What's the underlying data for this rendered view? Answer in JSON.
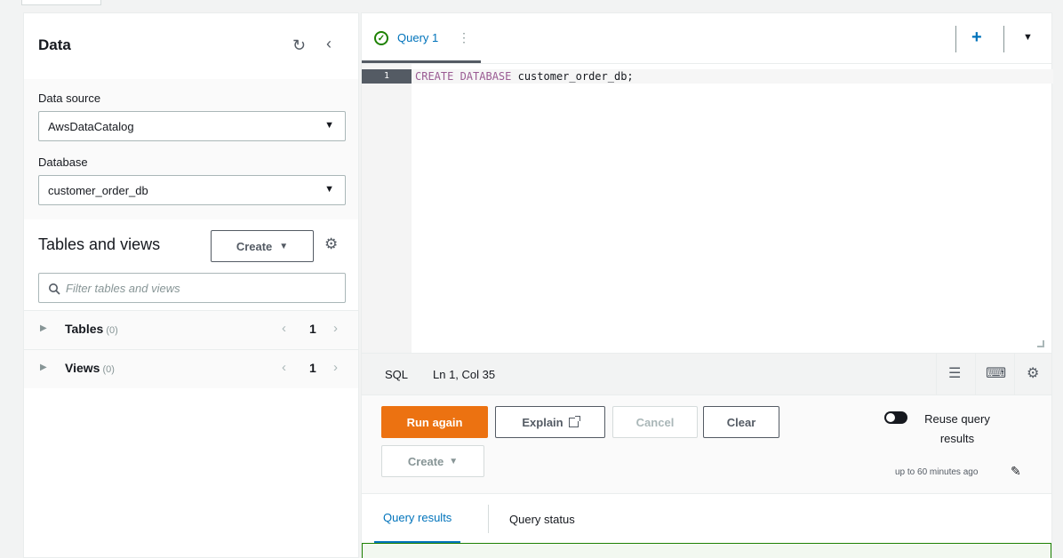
{
  "data_panel": {
    "title": "Data",
    "data_source_label": "Data source",
    "data_source_value": "AwsDataCatalog",
    "database_label": "Database",
    "database_value": "customer_order_db",
    "tables_views_title": "Tables and views",
    "create_label": "Create",
    "filter_placeholder": "Filter tables and views",
    "tree": [
      {
        "label": "Tables",
        "count": "(0)",
        "page": "1"
      },
      {
        "label": "Views",
        "count": "(0)",
        "page": "1"
      }
    ]
  },
  "editor": {
    "tab_label": "Query 1",
    "line_number": "1",
    "code_keyword": "CREATE DATABASE",
    "code_rest": " customer_order_db;",
    "status_language": "SQL",
    "status_position": "Ln 1, Col 35"
  },
  "actions": {
    "run_again": "Run again",
    "explain": "Explain",
    "cancel": "Cancel",
    "clear": "Clear",
    "create": "Create",
    "reuse_label": "Reuse query results",
    "reuse_sub": "up to 60 minutes ago"
  },
  "results": {
    "tab_results": "Query results",
    "tab_status": "Query status"
  },
  "icons": {
    "refresh": "refresh-icon",
    "collapse": "chevron-left-icon",
    "settings": "gear-icon",
    "search": "search-icon",
    "success": "check-circle-icon",
    "add": "plus-icon",
    "pencil": "pencil-icon"
  },
  "colors": {
    "primary": "#ec7211",
    "link": "#0073bb",
    "success": "#1d8102",
    "keyword": "#9a5b93"
  }
}
